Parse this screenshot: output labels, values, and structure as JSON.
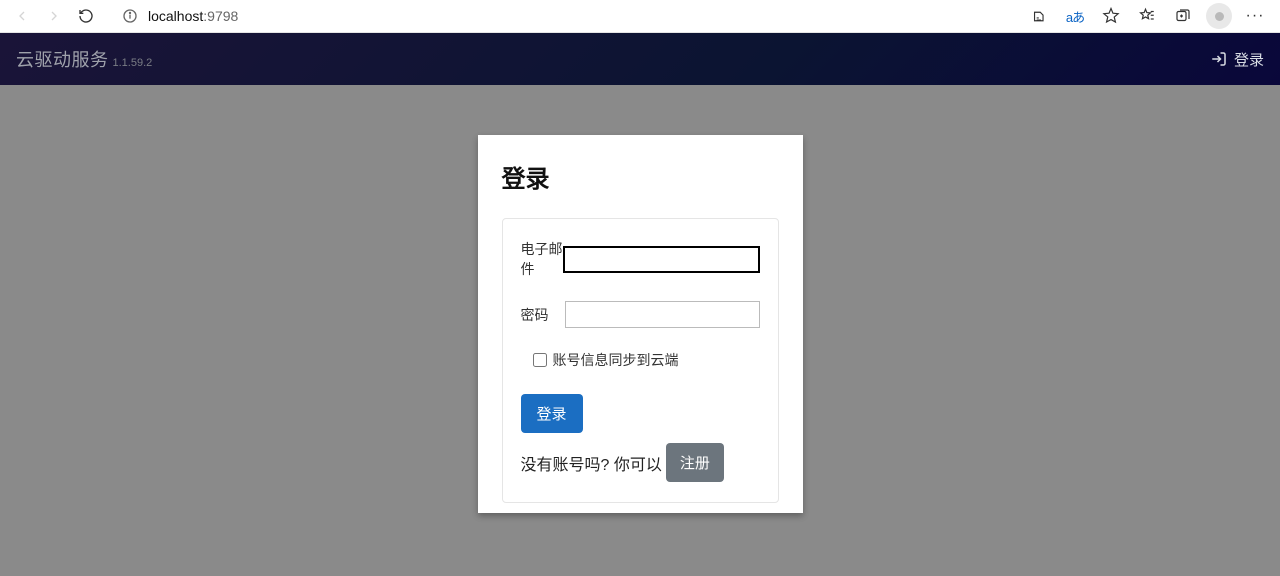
{
  "browser": {
    "url_host": "localhost",
    "url_port": ":9798"
  },
  "header": {
    "brand_name": "云驱动服务",
    "brand_version": "1.1.59.2",
    "login_label": "登录"
  },
  "login": {
    "title": "登录",
    "email_label": "电子邮件",
    "password_label": "密码",
    "sync_checkbox_label": "账号信息同步到云端",
    "submit_label": "登录",
    "no_account_text": "没有账号吗? 你可以",
    "register_label": "注册",
    "email_value": "",
    "password_value": ""
  }
}
